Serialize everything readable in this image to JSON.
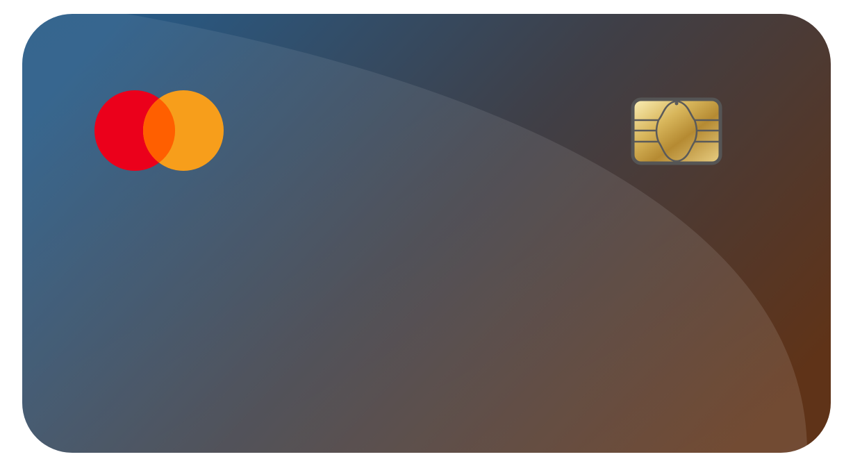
{
  "card": {
    "brand": "mastercard",
    "icons": {
      "logo": "mastercard-logo-icon",
      "chip": "emv-chip-icon"
    },
    "colors": {
      "background_start": "#275a86",
      "background_mid": "#3d3d45",
      "background_end": "#5f3318",
      "logo_red": "#eb001b",
      "logo_orange": "#f79e1b",
      "logo_overlap": "#ff5f00",
      "chip_gold_light": "#f3e2a0",
      "chip_gold_dark": "#b58a32",
      "chip_border": "#555555"
    }
  }
}
